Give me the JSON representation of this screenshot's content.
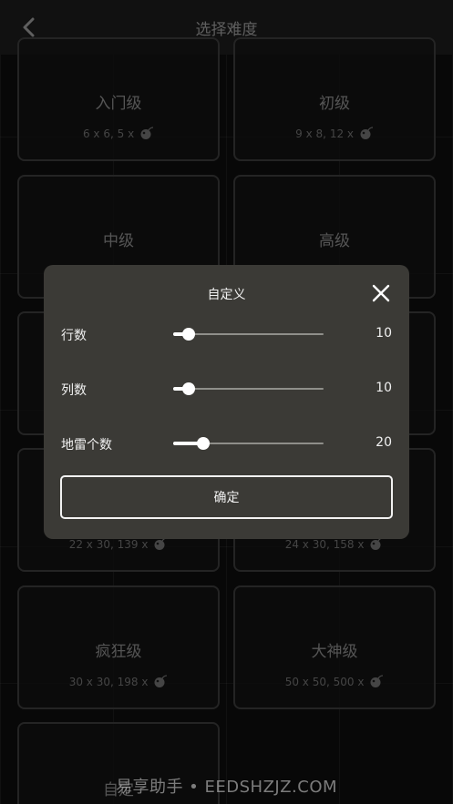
{
  "header": {
    "title": "选择难度",
    "back_icon": "chevron-left-icon"
  },
  "levels": [
    {
      "name": "入门级",
      "size": "6 x 6,",
      "mines": "5 x"
    },
    {
      "name": "初级",
      "size": "9 x 8,",
      "mines": "12 x"
    },
    {
      "name": "中级",
      "size": "",
      "mines": ""
    },
    {
      "name": "高级",
      "size": "",
      "mines": ""
    },
    {
      "name": "",
      "size": "",
      "mines": ""
    },
    {
      "name": "",
      "size": "",
      "mines": ""
    },
    {
      "name": "",
      "size": "22 x 30,",
      "mines": "139 x"
    },
    {
      "name": "",
      "size": "24 x 30,",
      "mines": "158 x"
    },
    {
      "name": "疯狂级",
      "size": "30 x 30,",
      "mines": "198 x"
    },
    {
      "name": "大神级",
      "size": "50 x 50,",
      "mines": "500 x"
    },
    {
      "name": "自定",
      "size": "",
      "mines": ""
    }
  ],
  "dialog": {
    "title": "自定义",
    "rows": [
      {
        "label": "行数",
        "value": "10",
        "fraction": 0.1
      },
      {
        "label": "列数",
        "value": "10",
        "fraction": 0.1
      },
      {
        "label": "地雷个数",
        "value": "20",
        "fraction": 0.2
      }
    ],
    "confirm_label": "确定"
  },
  "watermark": "易享助手 • EEDSHZJZ.COM"
}
